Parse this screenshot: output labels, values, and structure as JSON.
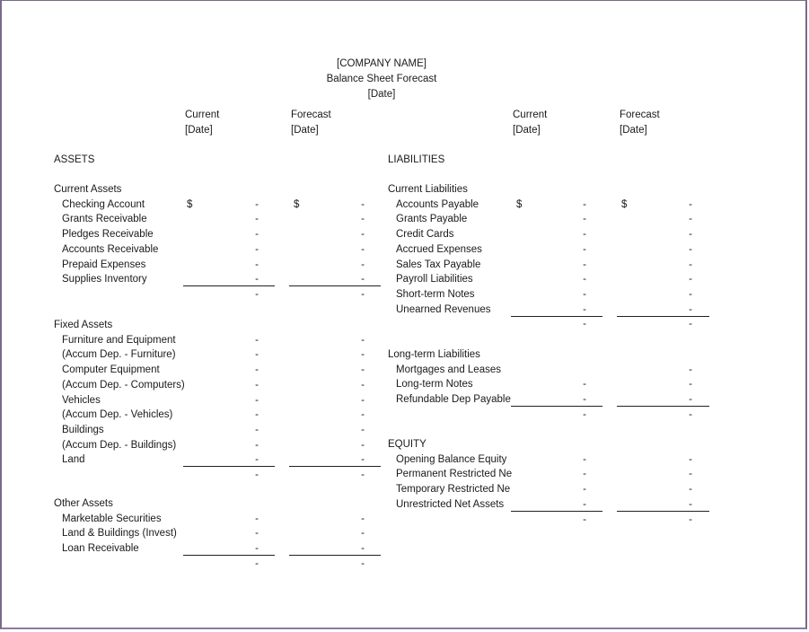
{
  "header": {
    "company": "[COMPANY NAME]",
    "title": "Balance Sheet Forecast",
    "date": "[Date]"
  },
  "columns": {
    "current_label": "Current",
    "forecast_label": "Forecast",
    "date_label": "[Date]"
  },
  "currency_symbol": "$",
  "empty_value": "-",
  "assets": {
    "heading": "ASSETS",
    "current": {
      "heading": "Current Assets",
      "items": [
        "Checking Account",
        "Grants Receivable",
        "Pledges Receivable",
        "Accounts Receivable",
        "Prepaid Expenses",
        "Supplies Inventory"
      ]
    },
    "fixed": {
      "heading": "Fixed Assets",
      "items": [
        "Furniture and Equipment",
        "(Accum Dep. - Furniture)",
        "Computer Equipment",
        "(Accum Dep. - Computers)",
        "Vehicles",
        "(Accum Dep. - Vehicles)",
        "Buildings",
        "(Accum Dep. - Buildings)",
        "Land"
      ]
    },
    "other": {
      "heading": "Other Assets",
      "items": [
        "Marketable Securities",
        "Land & Buildings (Invest)",
        "Loan Receivable"
      ]
    }
  },
  "liabilities": {
    "heading": "LIABILITIES",
    "current": {
      "heading": "Current Liabilities",
      "items": [
        "Accounts Payable",
        "Grants Payable",
        "Credit Cards",
        "Accrued Expenses",
        "Sales Tax Payable",
        "Payroll Liabilities",
        "Short-term Notes",
        "Unearned Revenues"
      ]
    },
    "long_term": {
      "heading": "Long-term Liabilities",
      "items": [
        "Mortgages and Leases",
        "Long-term Notes",
        "Refundable Dep Payable"
      ]
    }
  },
  "equity": {
    "heading": "EQUITY",
    "items": [
      "Opening Balance Equity",
      "Permanent Restricted Ne",
      "Temporary Restricted Ne",
      "Unrestricted Net Assets"
    ]
  }
}
